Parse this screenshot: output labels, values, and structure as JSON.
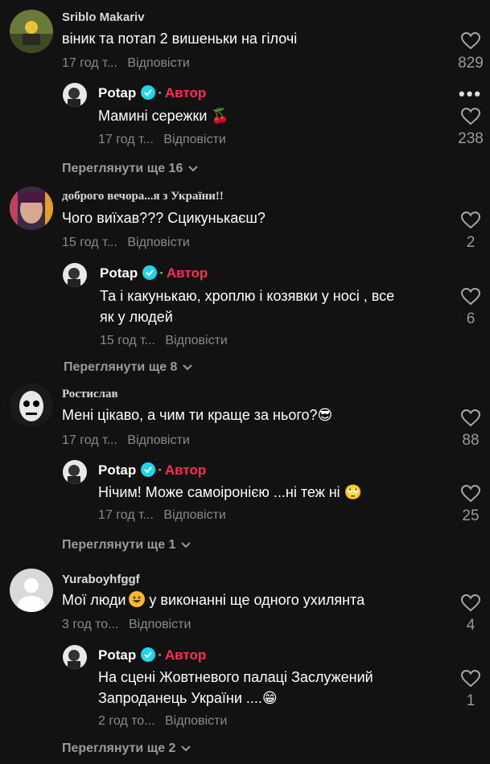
{
  "comments": [
    {
      "name": "Sriblo Makariv",
      "text": "віник та потап 2 вишеньки на гілочі",
      "time": "17 год т...",
      "reply": "Відповісти",
      "likes": "829",
      "reply_comment": {
        "name": "Potap",
        "badge": "Автор",
        "text": "Мамині сережки 🍒",
        "time": "17 год т...",
        "reply": "Відповісти",
        "likes": "238"
      },
      "view_more": "Переглянути ще 16"
    },
    {
      "name": "доброго вечора...я з України!!",
      "text": "Чого виїхав??? Сцикунькаєш?",
      "time": "15 год т...",
      "reply": "Відповісти",
      "likes": "2",
      "reply_comment": {
        "name": "Potap",
        "badge": "Автор",
        "text_line1": "Та і какунькаю, хроплю і козявки у носі , все",
        "text_line2": "як у людей",
        "time": "15 год т...",
        "reply": "Відповісти",
        "likes": "6"
      },
      "view_more": "Переглянути ще 8"
    },
    {
      "name": "Ростислав",
      "text": "Мені цікаво, а чим ти краще за нього?😎",
      "time": "17 год т...",
      "reply": "Відповісти",
      "likes": "88",
      "reply_comment": {
        "name": "Potap",
        "badge": "Автор",
        "text": "Нічим! Може самоіронією ...ні теж ні 🙄",
        "time": "17 год т...",
        "reply": "Відповісти",
        "likes": "25"
      },
      "view_more": "Переглянути ще 1"
    },
    {
      "name": "Yuraboyhfggf",
      "text_before": "Мої люди",
      "text_after": "у виконанні ще одного ухилянта",
      "time": "3 год то...",
      "reply": "Відповісти",
      "likes": "4",
      "reply_comment": {
        "name": "Potap",
        "badge": "Автор",
        "text_line1": "На сцені Жовтневого палаці Заслужений",
        "text_line2": "Запроданець України ....😁",
        "time": "2 год то...",
        "reply": "Відповісти",
        "likes": "1"
      },
      "view_more": "Переглянути ще 2"
    }
  ],
  "icons": {
    "like": "heart-outline-icon",
    "verified": "verified-check-icon",
    "expand": "chevron-down-icon",
    "menu": "more-dots-icon"
  },
  "colors": {
    "background": "#121212",
    "author_badge": "#fe2c55",
    "verified": "#20d5ec",
    "meta": "#8a8a8a"
  }
}
